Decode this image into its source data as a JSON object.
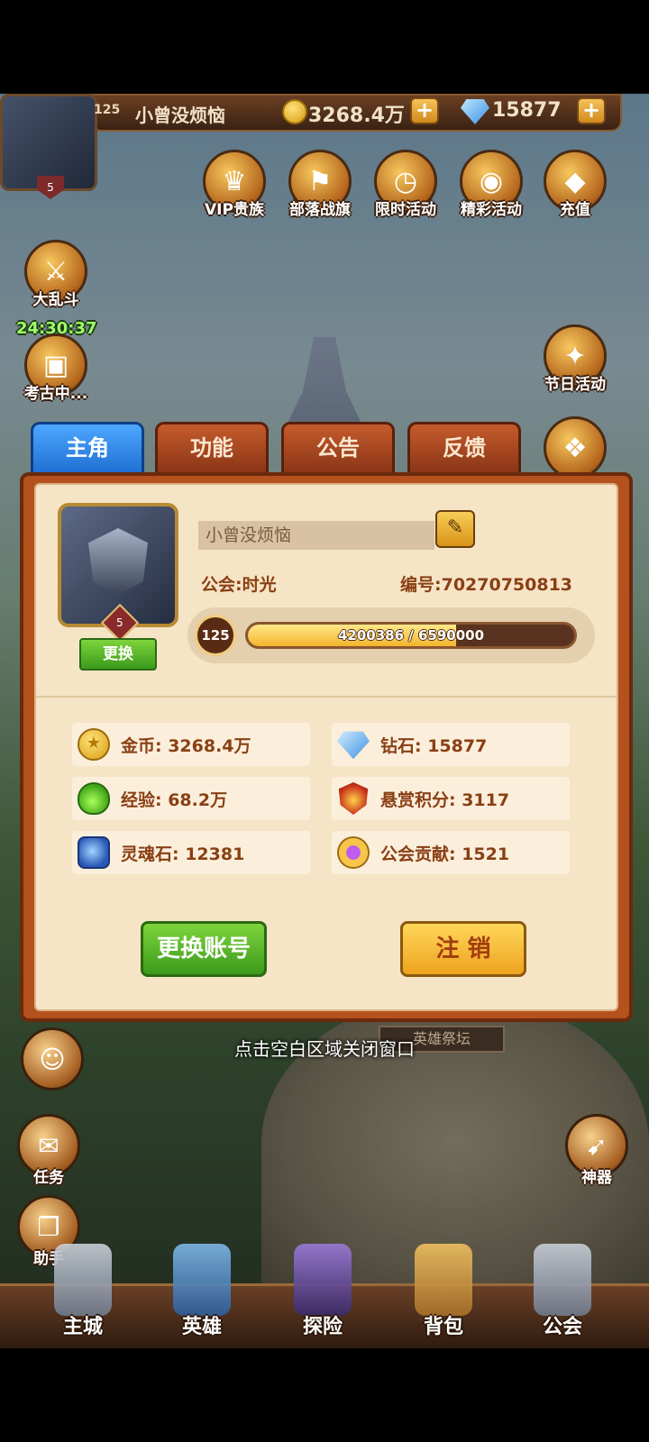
{
  "top_bar": {
    "level": "125",
    "player_name": "小曾没烦恼",
    "gold": "3268.4万",
    "diamonds": "15877",
    "plus": "+"
  },
  "top_icons": [
    {
      "label": "VIP贵族",
      "icon": "crown-icon"
    },
    {
      "label": "部落战旗",
      "icon": "banner-icon"
    },
    {
      "label": "限时活动",
      "icon": "compass-icon"
    },
    {
      "label": "精彩活动",
      "icon": "drum-icon"
    },
    {
      "label": "充值",
      "icon": "diamond-icon"
    }
  ],
  "left_icons": [
    {
      "label": "大乱斗",
      "icon": "crossed-swords-icon"
    },
    {
      "label": "考古中...",
      "icon": "treasure-chest-icon"
    }
  ],
  "timer": "24:30:37",
  "right_icons": [
    {
      "label": "节日活动",
      "icon": "gift-chest-icon"
    },
    {
      "label": "",
      "icon": "gift-box-icon"
    }
  ],
  "tabs": [
    "主角",
    "功能",
    "公告",
    "反馈"
  ],
  "profile": {
    "avatar_level": "5",
    "change_avatar": "更换",
    "name": "小曾没烦恼",
    "guild": "公会:时光",
    "player_id": "编号:70270750813",
    "level": "125",
    "exp_text": "4200386 / 6590000",
    "exp_fraction": 0.637
  },
  "stats": [
    {
      "icon": "gold-coin-icon",
      "text": "金币: 3268.4万"
    },
    {
      "icon": "diamond-icon",
      "text": "钻石: 15877"
    },
    {
      "icon": "exp-potion-icon",
      "text": "经验: 68.2万"
    },
    {
      "icon": "bounty-badge-icon",
      "text": "悬赏积分: 3117"
    },
    {
      "icon": "soul-stone-icon",
      "text": "灵魂石: 12381"
    },
    {
      "icon": "guild-medal-icon",
      "text": "公会贡献: 1521"
    }
  ],
  "buttons": {
    "switch_account": "更换账号",
    "logout": "注 销"
  },
  "close_hint": "点击空白区域关闭窗口",
  "shrine_label": "英雄祭坛",
  "side_buttons": [
    {
      "label": "",
      "icon": "chat-icon"
    },
    {
      "label": "任务",
      "icon": "scroll-icon"
    },
    {
      "label": "助手",
      "icon": "gift-icon"
    },
    {
      "label": "神器",
      "icon": "artifact-icon"
    }
  ],
  "bottom_nav": [
    "主城",
    "英雄",
    "探险",
    "背包",
    "公会"
  ]
}
